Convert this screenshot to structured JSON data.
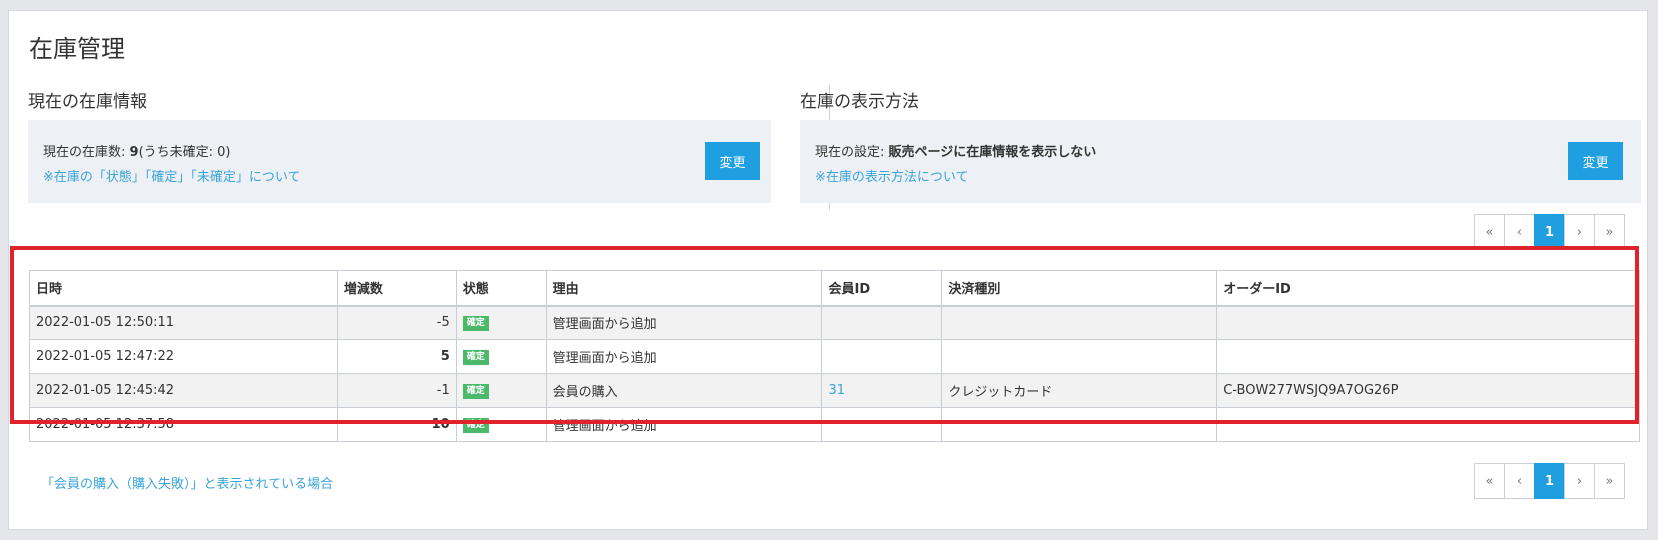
{
  "page": {
    "title": "在庫管理"
  },
  "stock_info": {
    "section_title": "現在の在庫情報",
    "label": "現在の在庫数: ",
    "count": "9",
    "unconfirmed": "(うち未確定: 0)",
    "link": "※在庫の「状態」「確定」「未確定」について",
    "button": "変更"
  },
  "display_method": {
    "section_title": "在庫の表示方法",
    "label": "現在の設定: ",
    "value": "販売ページに在庫情報を表示しない",
    "link": "※在庫の表示方法について",
    "button": "変更"
  },
  "pagination": {
    "first": "«",
    "prev": "‹",
    "current": "1",
    "next": "›",
    "last": "»"
  },
  "table": {
    "headers": [
      "日時",
      "増減数",
      "状態",
      "理由",
      "会員ID",
      "決済種別",
      "オーダーID"
    ],
    "rows": [
      {
        "datetime": "2022-01-05 12:50:11",
        "change": "-5",
        "status": "確定",
        "reason": "管理画面から追加",
        "member_id": "",
        "payment": "",
        "order_id": ""
      },
      {
        "datetime": "2022-01-05 12:47:22",
        "change": "5",
        "status": "確定",
        "reason": "管理画面から追加",
        "member_id": "",
        "payment": "",
        "order_id": ""
      },
      {
        "datetime": "2022-01-05 12:45:42",
        "change": "-1",
        "status": "確定",
        "reason": "会員の購入",
        "member_id": "31",
        "payment": "クレジットカード",
        "order_id": "C-BOW277WSJQ9A7OG26P"
      },
      {
        "datetime": "2022-01-05 12:37:58",
        "change": "10",
        "status": "確定",
        "reason": "管理画面から追加",
        "member_id": "",
        "payment": "",
        "order_id": ""
      }
    ]
  },
  "footer": {
    "link": "「会員の購入（購入失敗）」と表示されている場合"
  },
  "colors": {
    "accent": "#1f9ee0",
    "link": "#3aa4d8",
    "badge": "#4cb86a",
    "highlight": "#e0222a"
  }
}
